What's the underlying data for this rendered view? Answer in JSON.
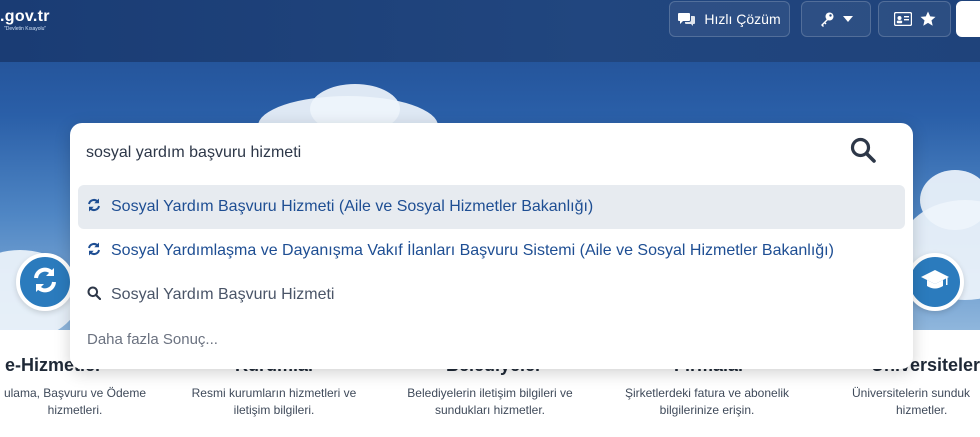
{
  "header": {
    "logo": ".gov.tr",
    "logo_tagline": "\"Devletin Kısayolu\"",
    "quick_solution_label": "Hızlı Çözüm"
  },
  "search": {
    "query": "sosyal yardım başvuru hizmeti",
    "suggestions": [
      {
        "label": "Sosyal Yardım Başvuru Hizmeti (Aile ve Sosyal Hizmetler Bakanlığı)",
        "icon": "refresh-icon"
      },
      {
        "label": "Sosyal Yardımlaşma ve Dayanışma Vakıf İlanları Başvuru Sistemi (Aile ve Sosyal Hizmetler Bakanlığı)",
        "icon": "refresh-icon"
      },
      {
        "label": "Sosyal Yardım Başvuru Hizmeti",
        "icon": "search-icon"
      }
    ],
    "more_results": "Daha fazla Sonuç..."
  },
  "categories": [
    {
      "title": "e-Hizmetler",
      "desc_line1": "ulama, Başvuru ve Ödeme",
      "desc_line2": "hizmetleri."
    },
    {
      "title": "Kurumlar",
      "desc_line1": "Resmi kurumların hizmetleri ve",
      "desc_line2": "iletişim bilgileri."
    },
    {
      "title": "Belediyeler",
      "desc_line1": "Belediyelerin iletişim bilgileri ve",
      "desc_line2": "sundukları hizmetler."
    },
    {
      "title": "Firmalar",
      "desc_line1": "Şirketlerdeki fatura ve abonelik",
      "desc_line2": "bilgilerinize erişin."
    },
    {
      "title": "Üniversiteler",
      "desc_line1": "Üniversitelerin sunduk",
      "desc_line2": "hizmetler."
    }
  ],
  "colors": {
    "header_bg": "#1a3c74",
    "accent": "#2b7bbd",
    "suggestion_text": "#1e4e93"
  }
}
